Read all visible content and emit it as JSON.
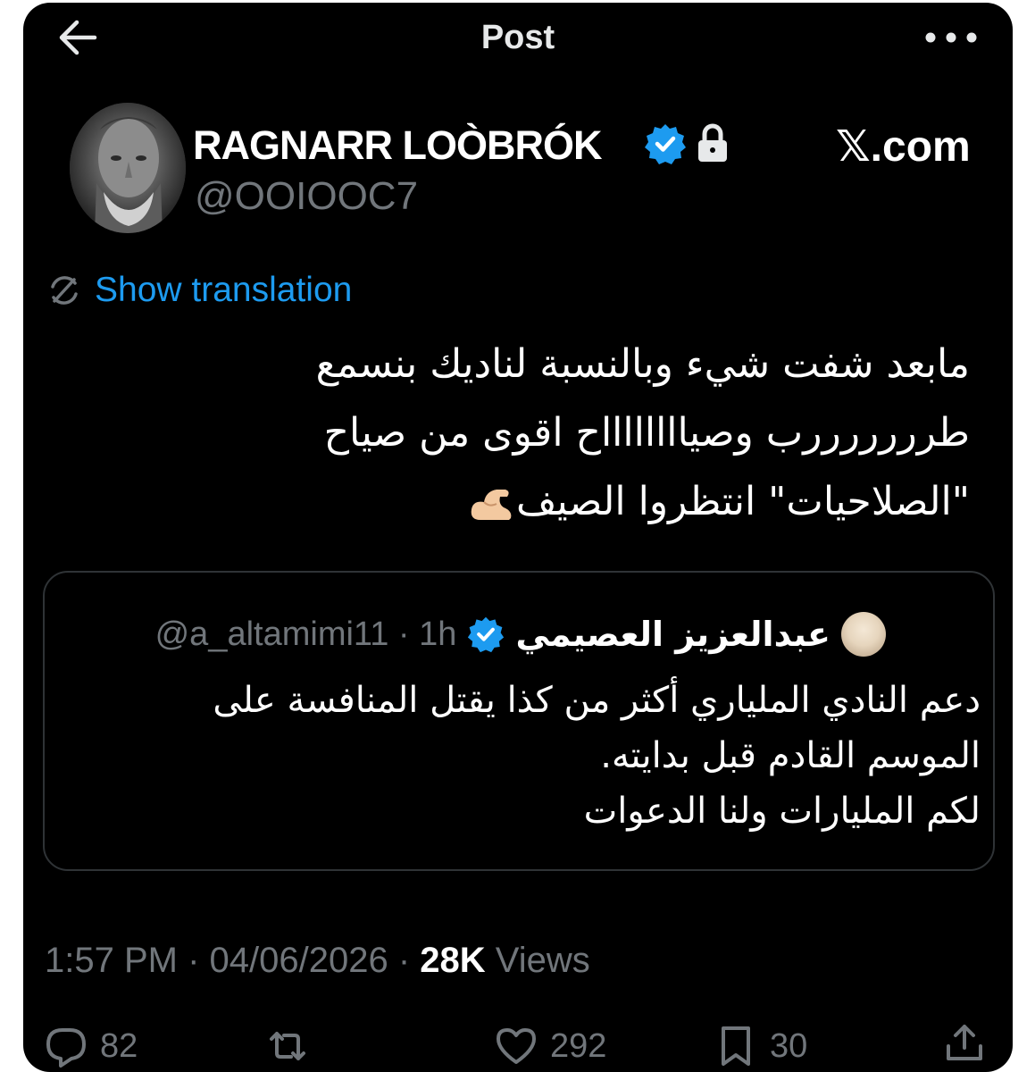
{
  "header": {
    "title": "Post",
    "back_icon": "arrow-left-icon",
    "more_icon": "more-horizontal-icon"
  },
  "author": {
    "name": "RAGNARR LOÒBRÓK",
    "handle": "@OOIOOC7",
    "verified": true,
    "protected": true
  },
  "watermark": "𝕏.com",
  "translation": {
    "label": "Show translation"
  },
  "tweet": {
    "lines": [
      "مابعد شفت شيء وبالنسبة لناديك بنسمع",
      "طرررررررب وصيااااااااح اقوى من صياح",
      "\"الصلاحيات\" انتظروا الصيف"
    ],
    "emoji": "flexed-biceps"
  },
  "quote": {
    "name": "عبدالعزيز العصيمي",
    "handle": "@a_altamimi11",
    "time": "1h",
    "verified": true,
    "lines": [
      "دعم النادي الملياري أكثر من كذا يقتل المنافسة على",
      "الموسم القادم قبل بدايته.",
      "لكم المليارات ولنا الدعوات"
    ]
  },
  "meta": {
    "time": "1:57 PM",
    "date": "04/06/2026",
    "views": "28K",
    "views_label": "Views"
  },
  "actions": {
    "replies": "82",
    "likes": "292",
    "bookmarks": "30"
  },
  "colors": {
    "background": "#000000",
    "text": "#e7e9ea",
    "muted": "#71767b",
    "accent": "#1d9bf0",
    "border": "#2f3336"
  }
}
